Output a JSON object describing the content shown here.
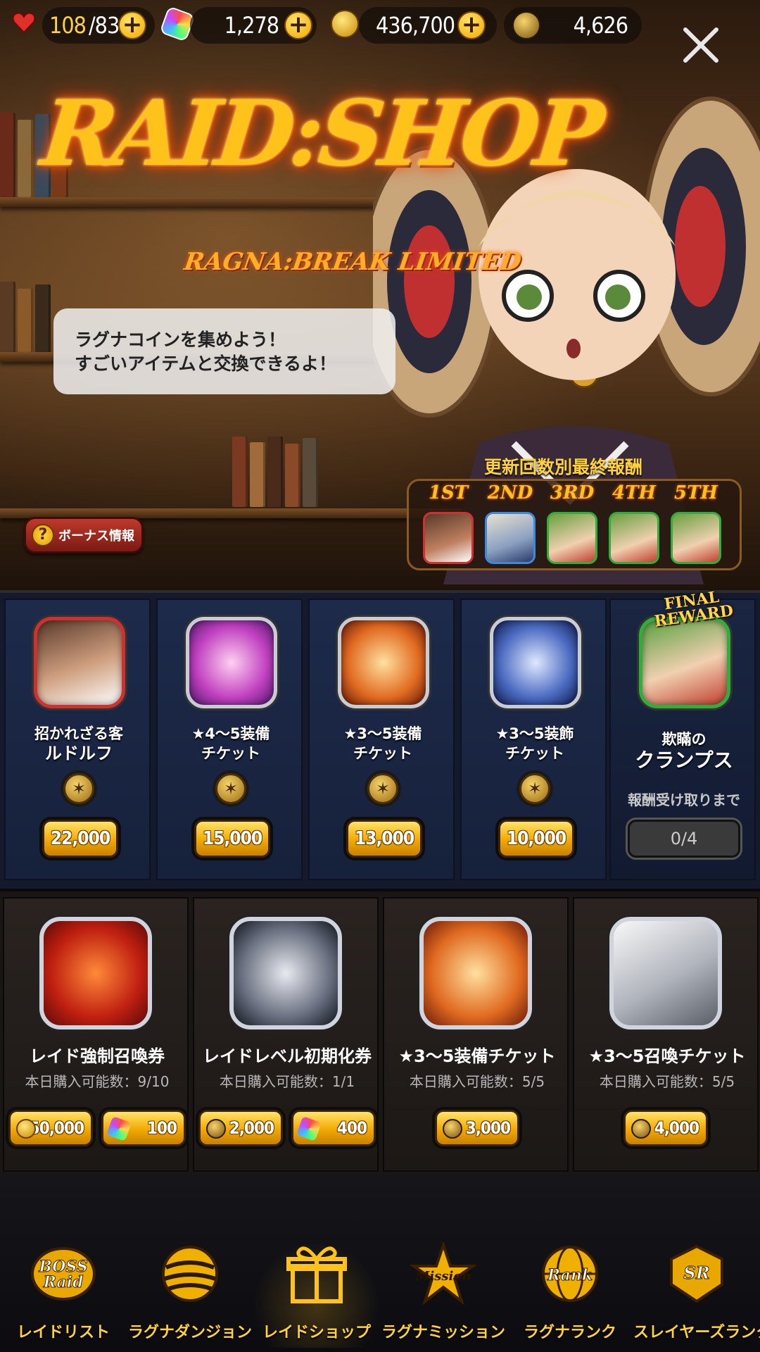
{
  "topbar": {
    "stamina": "108",
    "stamina_max": "/83",
    "gems": "1,278",
    "gold": "436,700",
    "ragna_coins": "4,626"
  },
  "hero": {
    "title": "RAID:SHOP",
    "subtitle": "RAGNA:BREAK LIMITED",
    "speech_line1": "ラグナコインを集めよう！",
    "speech_line2": "すごいアイテムと交換できるよ！",
    "reward_title": "更新回数別最終報酬",
    "ranks": [
      "1ST",
      "2ND",
      "3RD",
      "4TH",
      "5TH"
    ],
    "bonus_button": "ボーナス情報"
  },
  "section1": {
    "items": [
      {
        "name_line1": "招かれざる客",
        "name_line2": "ルドルフ",
        "price": "22,000"
      },
      {
        "name_line1": "★4～5装備",
        "name_line2": "チケット",
        "price": "15,000"
      },
      {
        "name_line1": "★3～5装備",
        "name_line2": "チケット",
        "price": "13,000"
      },
      {
        "name_line1": "★3～5装飾",
        "name_line2": "チケット",
        "price": "10,000"
      }
    ],
    "final": {
      "badge_line1": "FINAL",
      "badge_line2": "REWARD",
      "name_line1": "欺瞞の",
      "name_line2": "クランプス",
      "progress_label": "報酬受け取りまで",
      "progress": "0/4"
    }
  },
  "section2": {
    "items": [
      {
        "name": "レイド強制召喚券",
        "limit": "本日購入可能数：9/10",
        "price1": "50,000",
        "price2": "100"
      },
      {
        "name": "レイドレベル初期化券",
        "limit": "本日購入可能数：1/1",
        "price1": "2,000",
        "price2": "400"
      },
      {
        "name": "★3～5装備チケット",
        "limit": "本日購入可能数：5/5",
        "price1": "3,000"
      },
      {
        "name": "★3～5召喚チケット",
        "limit": "本日購入可能数：5/5",
        "price1": "4,000"
      }
    ]
  },
  "nav": {
    "items": [
      "レイドリスト",
      "ラグナダンジョン",
      "レイドショップ",
      "ラグナミッション",
      "ラグナランク",
      "スレイヤーズランク"
    ],
    "active_index": 2
  }
}
